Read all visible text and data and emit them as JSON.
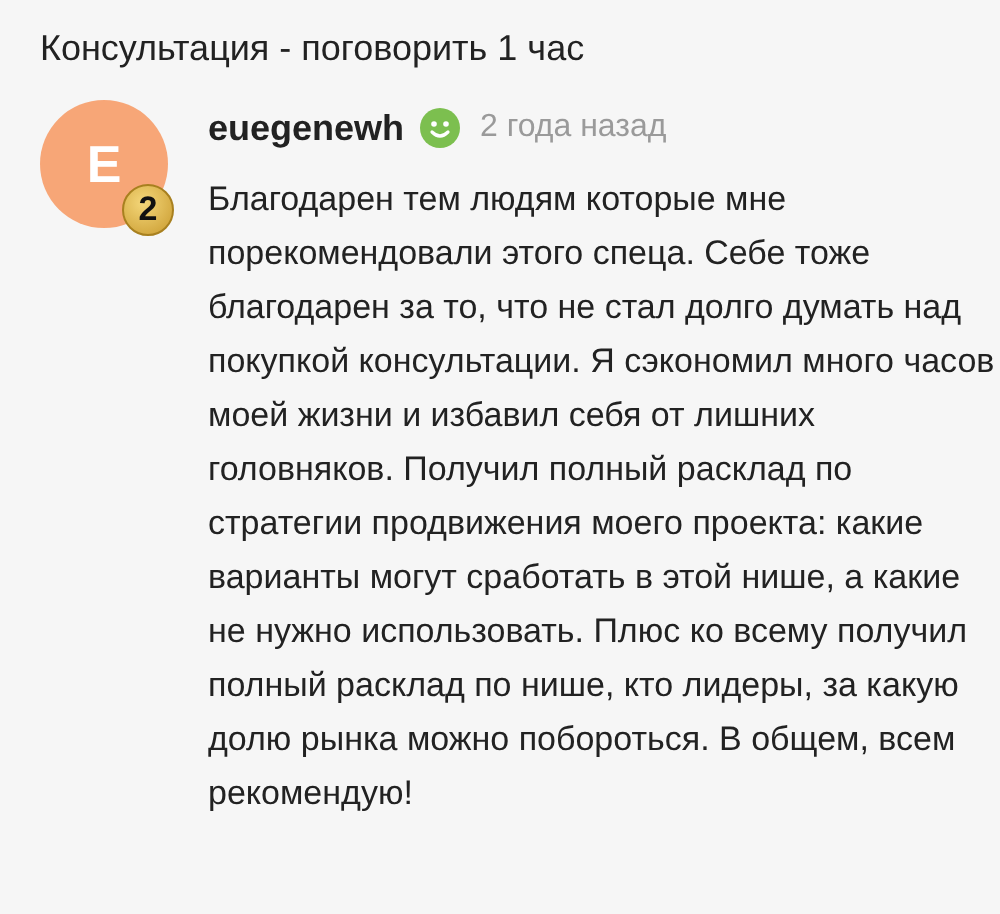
{
  "title": "Консультация - поговорить 1 час",
  "review": {
    "avatar_letter": "E",
    "badge": "2",
    "author": "euegenewh",
    "time": "2 года назад",
    "text": "Благодарен тем людям которые мне порекомендовали этого спеца. Себе тоже благодарен за то, что не стал долго думать над покупкой консультации. Я сэкономил много часов моей жизни и избавил себя от лишних головняков. Получил полный расклад по стратегии продвижения моего проекта: какие варианты могут сработать в этой нише, а какие не нужно использовать. Плюс ко всему получил полный расклад по нише, кто лидеры, за какую долю рынка можно побороться. В общем, всем рекомендую!"
  }
}
